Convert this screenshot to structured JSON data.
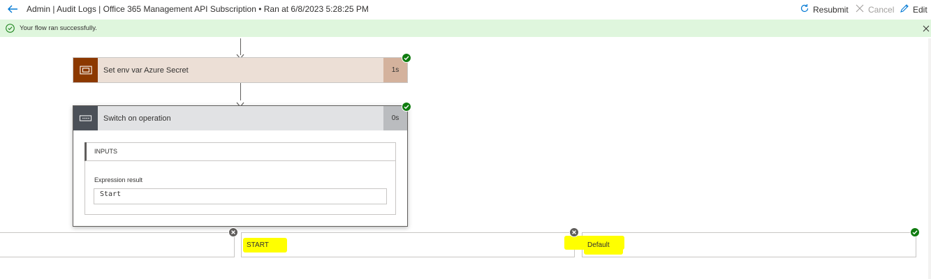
{
  "header": {
    "title": "Admin | Audit Logs | Office 365 Management API Subscription • Ran at 6/8/2023 5:28:25 PM",
    "resubmit_label": "Resubmit",
    "cancel_label": "Cancel",
    "edit_label": "Edit"
  },
  "banner": {
    "message": "Your flow ran successfully."
  },
  "actions": [
    {
      "title": "Set env var Azure Secret",
      "duration": "1s",
      "status": "succeeded"
    },
    {
      "title": "Switch on operation",
      "duration": "0s",
      "status": "succeeded"
    }
  ],
  "switch_details": {
    "section_label": "INPUTS",
    "expression_label": "Expression result",
    "expression_value": "Start"
  },
  "cases": [
    {
      "label": "",
      "status": "skipped"
    },
    {
      "label": "START",
      "status": "skipped"
    },
    {
      "label": "Default",
      "status": "succeeded"
    }
  ],
  "colors": {
    "accent": "#0078d4",
    "success": "#107c10",
    "success_bg": "#dff6dd",
    "variable_icon_bg": "#8c3900",
    "variable_card_bg": "#ecdfd6",
    "variable_duration_bg": "#d4b29d",
    "control_icon_bg": "#4b5058",
    "control_card_bg": "#e1e2e4",
    "control_duration_bg": "#babcbf",
    "highlight": "#ffff00"
  }
}
